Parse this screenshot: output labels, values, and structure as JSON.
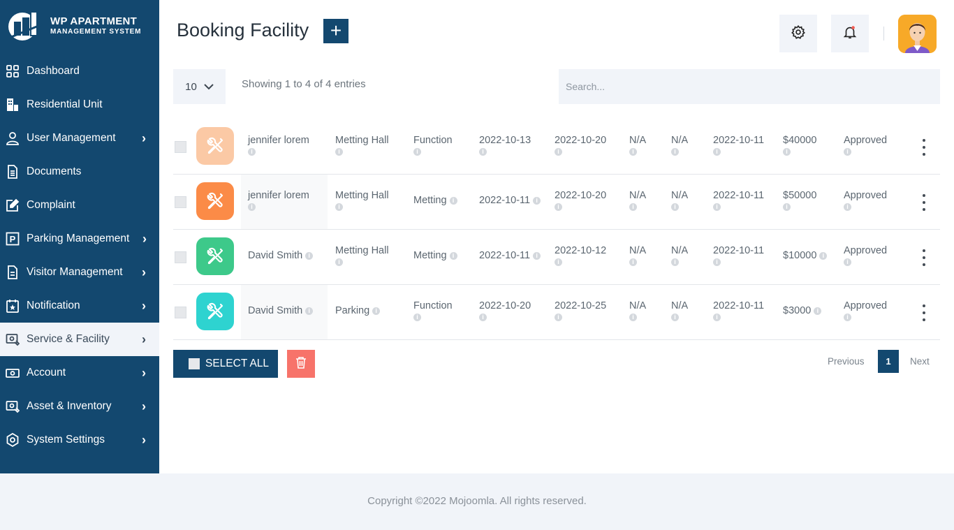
{
  "brand": {
    "title": "WP APARTMENT",
    "subtitle": "MANAGEMENT SYSTEM"
  },
  "sidebar": {
    "items": [
      {
        "label": "Dashboard",
        "icon": "dashboard-grid-icon",
        "chevron": false
      },
      {
        "label": "Residential Unit",
        "icon": "building-icon",
        "chevron": false
      },
      {
        "label": "User Management",
        "icon": "user-icon",
        "chevron": true
      },
      {
        "label": "Documents",
        "icon": "document-icon",
        "chevron": false
      },
      {
        "label": "Complaint",
        "icon": "edit-icon",
        "chevron": false
      },
      {
        "label": "Parking Management",
        "icon": "parking-icon",
        "chevron": true
      },
      {
        "label": "Visitor Management",
        "icon": "visitor-icon",
        "chevron": true
      },
      {
        "label": "Notification",
        "icon": "calendar-star-icon",
        "chevron": true
      },
      {
        "label": "Service & Facility",
        "icon": "service-icon",
        "chevron": true,
        "active": true
      },
      {
        "label": "Account",
        "icon": "money-icon",
        "chevron": true
      },
      {
        "label": "Asset & Inventory",
        "icon": "asset-icon",
        "chevron": true
      },
      {
        "label": "System Settings",
        "icon": "settings-icon",
        "chevron": true
      }
    ]
  },
  "header": {
    "title": "Booking Facility",
    "add_label": "+"
  },
  "table_controls": {
    "length_value": "10",
    "info": "Showing 1 to 4 of 4 entries",
    "search_placeholder": "Search..."
  },
  "rows": [
    {
      "icon_color": "#fbc9a5",
      "name": "jennifer lorem",
      "facility": "Metting Hall",
      "type": "Function",
      "start": "2022-10-13",
      "end": "2022-10-20",
      "col7": "N/A",
      "col8": "N/A",
      "date": "2022-10-11",
      "amount": "$40000",
      "status": "Approved"
    },
    {
      "icon_color": "#fb8b47",
      "name": "jennifer lorem",
      "facility": "Metting Hall",
      "type": "Metting",
      "start": "2022-10-11",
      "end": "2022-10-20",
      "col7": "N/A",
      "col8": "N/A",
      "date": "2022-10-11",
      "amount": "$50000",
      "status": "Approved"
    },
    {
      "icon_color": "#3dc98a",
      "name": "David Smith",
      "facility": "Metting Hall",
      "type": "Metting",
      "start": "2022-10-11",
      "end": "2022-10-12",
      "col7": "N/A",
      "col8": "N/A",
      "date": "2022-10-11",
      "amount": "$10000",
      "status": "Approved"
    },
    {
      "icon_color": "#2ed3d0",
      "name": "David Smith",
      "facility": "Parking",
      "type": "Function",
      "start": "2022-10-20",
      "end": "2022-10-25",
      "col7": "N/A",
      "col8": "N/A",
      "date": "2022-10-11",
      "amount": "$3000",
      "status": "Approved"
    }
  ],
  "actions": {
    "select_all": "SELECT ALL"
  },
  "pagination": {
    "previous": "Previous",
    "current": "1",
    "next": "Next"
  },
  "footer": {
    "copyright": "Copyright ©2022 Mojoomla. All rights reserved."
  },
  "colors": {
    "primary": "#13486f",
    "danger": "#f7736a",
    "surface": "#f1f4f9"
  }
}
